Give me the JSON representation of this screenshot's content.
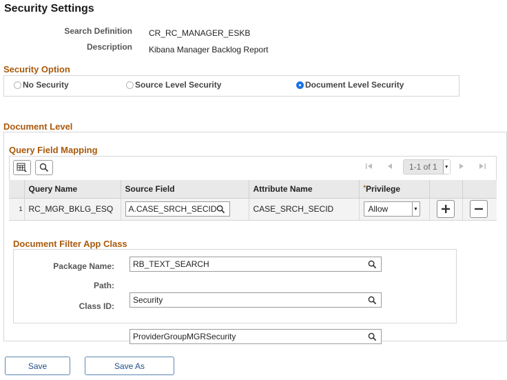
{
  "page": {
    "title": "Security Settings"
  },
  "header": {
    "search_definition_label": "Search Definition",
    "search_definition_value": "CR_RC_MANAGER_ESKB",
    "description_label": "Description",
    "description_value": "Kibana Manager Backlog Report"
  },
  "security_option": {
    "title": "Security Option",
    "options": [
      {
        "label": "No Security",
        "selected": false
      },
      {
        "label": "Source Level Security",
        "selected": false
      },
      {
        "label": "Document Level Security",
        "selected": true
      }
    ]
  },
  "document_level": {
    "title": "Document Level",
    "query_field_mapping": {
      "title": "Query Field Mapping",
      "pager": "1-1 of 1",
      "columns": [
        "Query Name",
        "Source Field",
        "Attribute Name",
        "Privilege"
      ],
      "required_marker": "*",
      "rows": [
        {
          "row_number": "1",
          "query_name": "RC_MGR_BKLG_ESQ",
          "source_field": "A.CASE_SRCH_SECID",
          "attribute_name": "CASE_SRCH_SECID",
          "privilege": "Allow"
        }
      ]
    },
    "filter_app_class": {
      "title": "Document Filter App Class",
      "package_label": "Package Name:",
      "package_value": "RB_TEXT_SEARCH",
      "path_label": "Path:",
      "path_value": "Security",
      "class_label": "Class ID:",
      "class_value": "ProviderGroupMGRSecurity"
    }
  },
  "actions": {
    "save_label": "Save",
    "save_as_label": "Save As"
  },
  "colors": {
    "section_title": "#a8590b",
    "radio_selected": "#1a73e8",
    "button_text": "#1d4f86"
  }
}
